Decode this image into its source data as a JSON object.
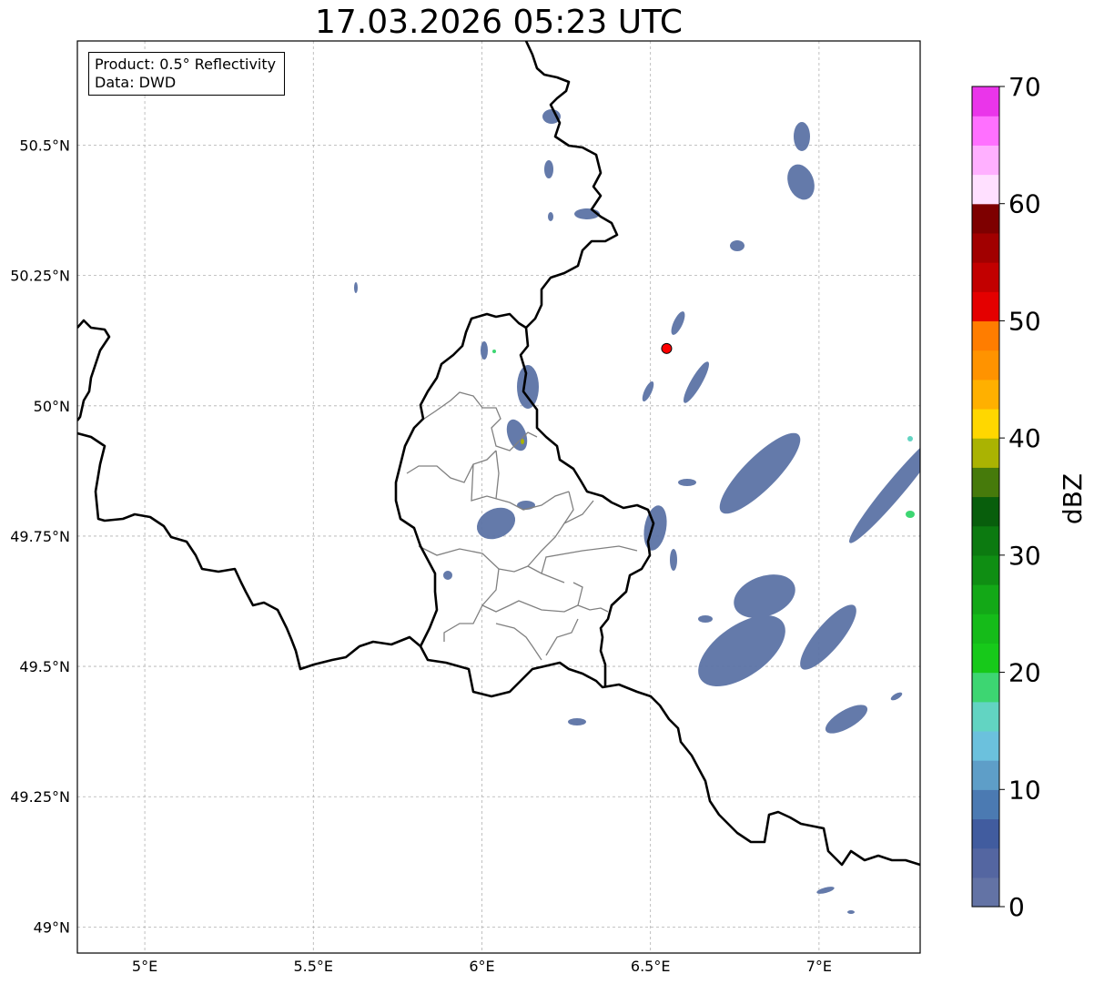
{
  "title": "17.03.2026 05:23 UTC",
  "info": {
    "product_line": "Product: 0.5° Reflectivity",
    "data_line": "Data: DWD"
  },
  "map": {
    "lon_range": [
      4.8,
      7.3
    ],
    "lat_range": [
      48.95,
      50.7
    ],
    "x_ticks": [
      {
        "value": 5.0,
        "label": "5°E"
      },
      {
        "value": 5.5,
        "label": "5.5°E"
      },
      {
        "value": 6.0,
        "label": "6°E"
      },
      {
        "value": 6.5,
        "label": "6.5°E"
      },
      {
        "value": 7.0,
        "label": "7°E"
      }
    ],
    "y_ticks": [
      {
        "value": 49.0,
        "label": "49°N"
      },
      {
        "value": 49.25,
        "label": "49.25°N"
      },
      {
        "value": 49.5,
        "label": "49.5°N"
      },
      {
        "value": 49.75,
        "label": "49.75°N"
      },
      {
        "value": 50.0,
        "label": "50°N"
      },
      {
        "value": 50.25,
        "label": "50.25°N"
      },
      {
        "value": 50.5,
        "label": "50.5°N"
      }
    ],
    "grid": true,
    "radar_site": {
      "lon": 6.548,
      "lat": 50.11,
      "color": "#ff0000"
    }
  },
  "colorbar": {
    "label": "dBZ",
    "range": [
      0,
      70
    ],
    "tick_labels": [
      "0",
      "10",
      "20",
      "30",
      "40",
      "50",
      "60",
      "70"
    ],
    "colors": [
      "#6373a5",
      "#5466a1",
      "#415c9f",
      "#4b7ab2",
      "#5e9ec8",
      "#6bc1dd",
      "#62d4c2",
      "#3dd672",
      "#17c91a",
      "#15bb19",
      "#13a817",
      "#0f8e13",
      "#0c7a10",
      "#085e0c",
      "#467a0b",
      "#aab302",
      "#ffd700",
      "#ffb000",
      "#ff9300",
      "#ff7d00",
      "#e40000",
      "#c20000",
      "#a10000",
      "#7e0000",
      "#ffe0ff",
      "#ffb0ff",
      "#ff70ff",
      "#ea35ea"
    ]
  }
}
